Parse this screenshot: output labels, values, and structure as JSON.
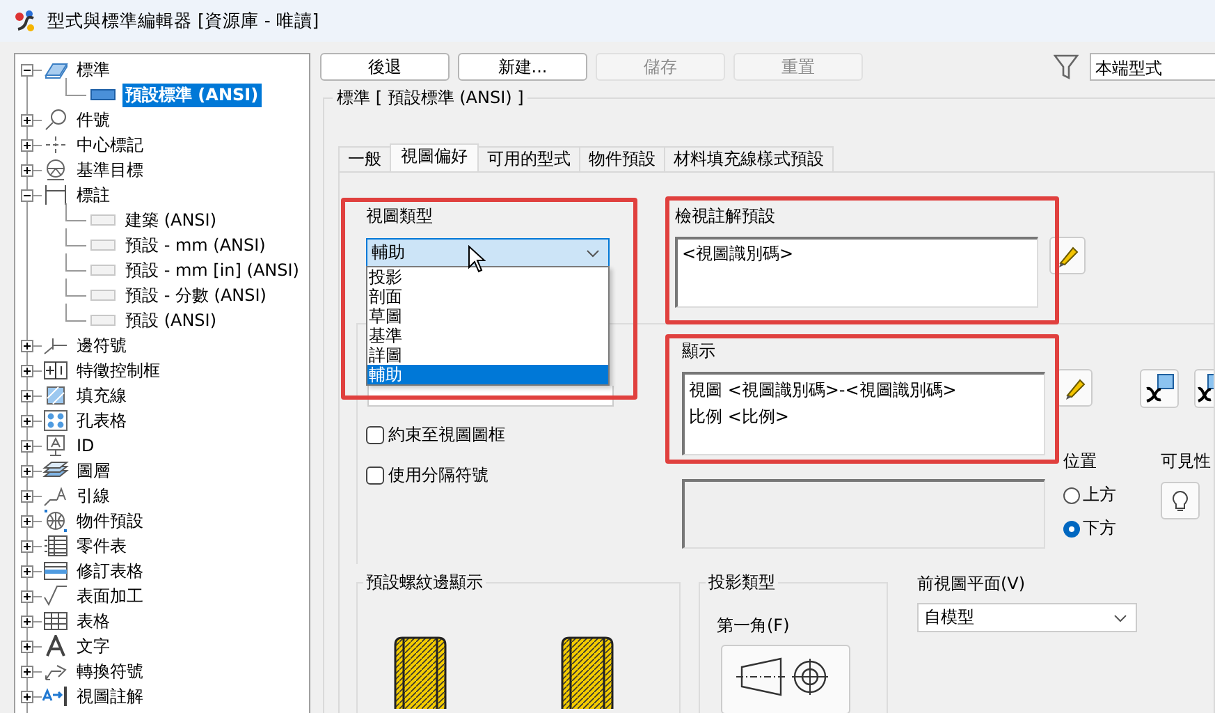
{
  "window": {
    "title": "型式與標準編輯器 [資源庫 - 唯讀]"
  },
  "tree": [
    {
      "label": "標準",
      "expanded": true,
      "children": [
        {
          "label": "預設標準 (ANSI)",
          "selected": true
        }
      ]
    },
    {
      "label": "件號",
      "expanded": false
    },
    {
      "label": "中心標記",
      "expanded": false
    },
    {
      "label": "基準目標",
      "expanded": false
    },
    {
      "label": "標註",
      "expanded": true,
      "children": [
        {
          "label": "建築 (ANSI)",
          "selected": false
        },
        {
          "label": "預設 - mm (ANSI)",
          "selected": false
        },
        {
          "label": "預設 - mm [in] (ANSI)",
          "selected": false
        },
        {
          "label": "預設 - 分數 (ANSI)",
          "selected": false
        },
        {
          "label": "預設 (ANSI)",
          "selected": false
        }
      ]
    },
    {
      "label": "邊符號",
      "expanded": false
    },
    {
      "label": "特徵控制框",
      "expanded": false
    },
    {
      "label": "填充線",
      "expanded": false
    },
    {
      "label": "孔表格",
      "expanded": false
    },
    {
      "label": "ID",
      "expanded": false
    },
    {
      "label": "圖層",
      "expanded": false
    },
    {
      "label": "引線",
      "expanded": false
    },
    {
      "label": "物件預設",
      "expanded": false
    },
    {
      "label": "零件表",
      "expanded": false
    },
    {
      "label": "修訂表格",
      "expanded": false
    },
    {
      "label": "表面加工",
      "expanded": false
    },
    {
      "label": "表格",
      "expanded": false
    },
    {
      "label": "文字",
      "expanded": false
    },
    {
      "label": "轉換符號",
      "expanded": false
    },
    {
      "label": "視圖註解",
      "expanded": false
    }
  ],
  "toolbar": [
    {
      "label": "後退",
      "disabled": false
    },
    {
      "label": "新建...",
      "disabled": false
    },
    {
      "label": "儲存",
      "disabled": true
    },
    {
      "label": "重置",
      "disabled": true
    }
  ],
  "filter": {
    "value": "本端型式"
  },
  "group_title": "標準 [ 預設標準 (ANSI) ]",
  "tabs": [
    {
      "label": "一般",
      "selected": false
    },
    {
      "label": "視圖偏好",
      "selected": true
    },
    {
      "label": "可用的型式",
      "selected": false
    },
    {
      "label": "物件預設",
      "selected": false
    },
    {
      "label": "材料填充線樣式預設",
      "selected": false
    }
  ],
  "view_type": {
    "label": "視圖類型",
    "value": "輔助",
    "options": [
      {
        "label": "投影",
        "selected": false
      },
      {
        "label": "剖面",
        "selected": false
      },
      {
        "label": "草圖",
        "selected": false
      },
      {
        "label": "基準",
        "selected": false
      },
      {
        "label": "詳圖",
        "selected": false
      },
      {
        "label": "輔助",
        "selected": true
      }
    ]
  },
  "annotation_default": {
    "label": "檢視註解預設",
    "value": "<視圖識別碼>"
  },
  "display": {
    "label": "顯示",
    "lines": [
      "視圖 <視圖識別碼>-<視圖識別碼>",
      "比例 <比例>"
    ]
  },
  "checkboxes": [
    {
      "label": "約束至視圖圖框",
      "checked": false
    },
    {
      "label": "使用分隔符號",
      "checked": false
    }
  ],
  "position": {
    "label": "位置",
    "options": [
      {
        "label": "上方",
        "selected": false
      },
      {
        "label": "下方",
        "selected": true
      }
    ]
  },
  "visibility": {
    "label": "可見性"
  },
  "thread_display": {
    "title": "預設螺紋邊顯示"
  },
  "projection": {
    "title": "投影類型",
    "option": "第一角(F)"
  },
  "front_plane": {
    "label": "前視圖平面(V)",
    "value": "自模型"
  }
}
